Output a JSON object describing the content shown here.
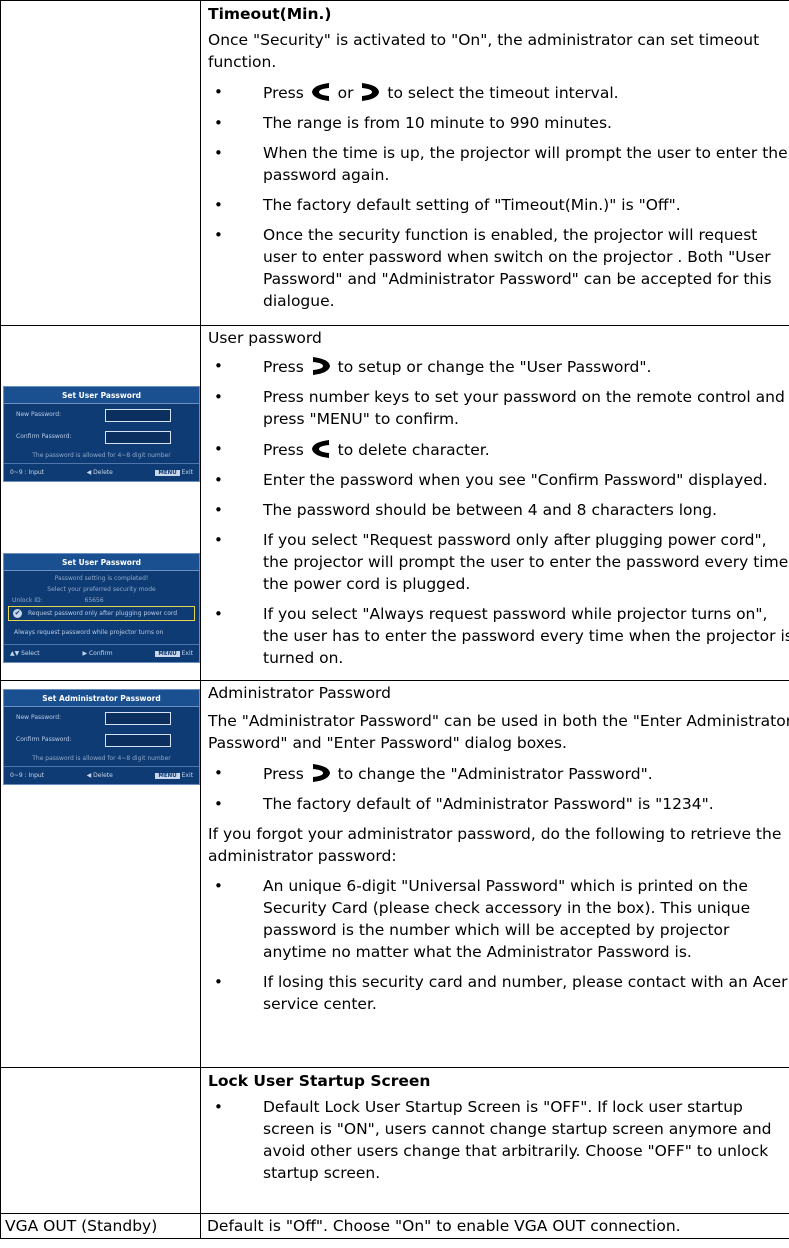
{
  "sec_timeout": {
    "title": "Timeout(Min.)",
    "intro": "Once \"Security\" is activated to \"On\", the administrator can set timeout function.",
    "b1_pre": "Press ",
    "b1_mid": " or ",
    "b1_post": " to select the timeout interval.",
    "b2": "The range is from 10 minute to 990 minutes.",
    "b3": "When the time is up, the projector will prompt the user to enter the password again.",
    "b4": "The factory default setting of \"Timeout(Min.)\" is \"Off\".",
    "b5": "Once the security function is enabled, the projector will request user to enter password when switch on the projector . Both \"User Password\" and \"Administrator Password\" can be accepted for this dialogue."
  },
  "sec_user": {
    "title": "User password",
    "b1_pre": "Press ",
    "b1_post": " to setup or change the \"User Password\".",
    "b2": "Press number keys to set your password on the remote control and press \"MENU\" to confirm.",
    "b3_pre": "Press ",
    "b3_post": " to delete character.",
    "b4": "Enter the password when you see \"Confirm Password\" displayed.",
    "b5": "The password should be between 4 and 8 characters long.",
    "b6": "If you select \"Request password only after plugging power cord\", the projector will prompt the user to enter the password every time the power cord is plugged.",
    "b7": "If you select \"Always request password while projector turns on\", the user has to enter the password every time when the projector is turned on."
  },
  "sec_admin": {
    "title": "Administrator Password",
    "intro": "The \"Administrator Password\" can be used in both the \"Enter Administrator Password\" and \"Enter Password\" dialog boxes.",
    "b1_pre": "Press ",
    "b1_post": " to change the \"Administrator Password\".",
    "b2": "The factory default of \"Administrator Password\" is \"1234\".",
    "para2": "If you forgot your administrator password, do the following to retrieve the administrator password:",
    "b3": "An unique 6-digit \"Universal Password\" which is printed on the Security Card (please check accessory in the box). This unique password is the number which will be accepted by projector anytime no matter what the Administrator Password is.",
    "b4": "If losing this security card and number, please contact with an Acer service center."
  },
  "sec_lock": {
    "title": "Lock User Startup Screen",
    "b1": "Default Lock User Startup Screen is \"OFF\". If lock user startup screen is \"ON\", users cannot change startup screen anymore and avoid other users change that arbitrarily. Choose \"OFF\" to unlock startup screen."
  },
  "sec_vga": {
    "label": "VGA OUT (Standby)",
    "text": "Default is \"Off\". Choose \"On\" to enable VGA OUT connection."
  },
  "osd_user1": {
    "title": "Set User Password",
    "new": "New Password:",
    "confirm": "Confirm Password:",
    "note": "The password is allowed for 4~8 digit number",
    "f1": "0~9 : Input",
    "f2": "◀ Delete",
    "f3": "MENU",
    "f4": "Exit"
  },
  "osd_user2": {
    "title": "Set User Password",
    "line1": "Password setting is completed!",
    "line2": "Select your preferred security mode",
    "unlock_label": "Unlock ID:",
    "unlock_value": "65656",
    "opt1": "Request password only after plugging power cord",
    "opt2": "Always request password while projector turns on",
    "f1": "▲▼ Select",
    "f2": "▶ Confirm",
    "f3": "MENU",
    "f4": "Exit"
  },
  "osd_admin": {
    "title": "Set Administrator Password",
    "new": "New Password:",
    "confirm": "Confirm Password:",
    "note": "The password is allowed for 4~8 digit number",
    "f1": "0~9 : Input",
    "f2": "◀ Delete",
    "f3": "MENU",
    "f4": "Exit"
  },
  "bullet_glyph": "•"
}
